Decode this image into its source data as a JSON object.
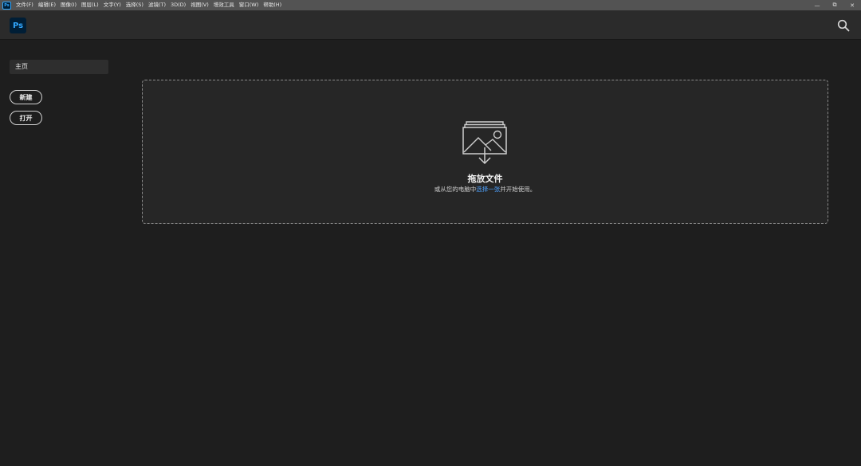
{
  "menubar": {
    "logo": "Ps",
    "items": [
      "文件(F)",
      "编辑(E)",
      "图像(I)",
      "图层(L)",
      "文字(Y)",
      "选择(S)",
      "滤镜(T)",
      "3D(D)",
      "视图(V)",
      "增效工具",
      "窗口(W)",
      "帮助(H)"
    ],
    "controls": {
      "minimize": "—",
      "restore": "⧉",
      "close": "✕"
    }
  },
  "header": {
    "logo": "Ps",
    "search_icon": "search-icon"
  },
  "sidebar": {
    "home_label": "主页",
    "new_label": "新建",
    "open_label": "打开"
  },
  "dropzone": {
    "icon": "image-stack-drop-icon",
    "title": "拖放文件",
    "subtitle_before": "或从您的电脑中",
    "subtitle_link": "选择一张",
    "subtitle_after": "并开始使用。"
  },
  "colors": {
    "menubar_bg": "#535353",
    "header_bg": "#2b2b2b",
    "workspace_bg": "#1e1e1e",
    "ps_blue": "#31a8ff",
    "link_blue": "#4ea2ff"
  }
}
